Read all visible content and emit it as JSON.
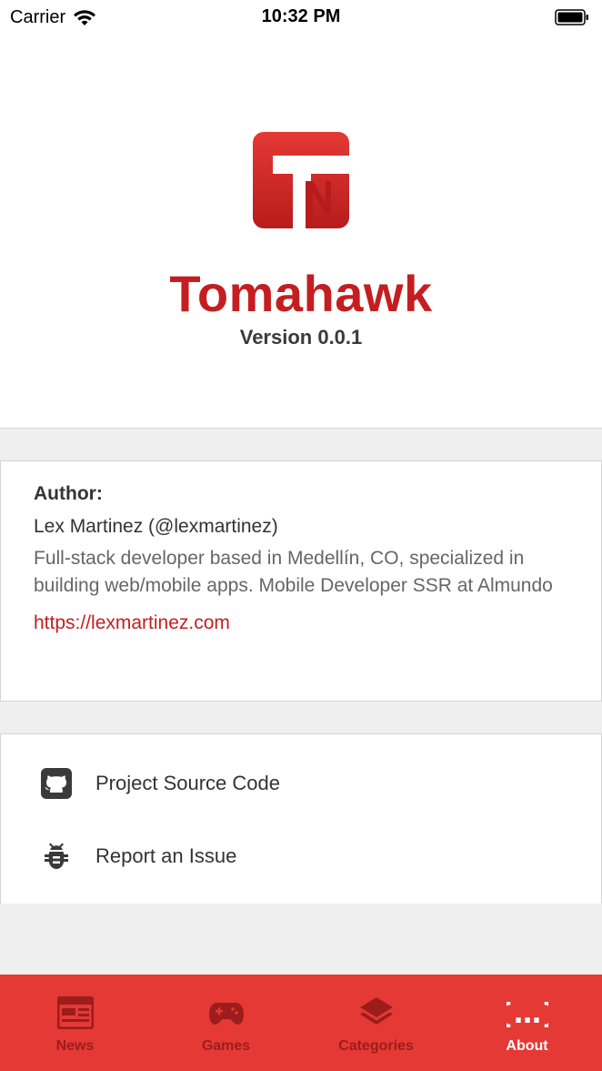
{
  "status_bar": {
    "carrier": "Carrier",
    "time": "10:32 PM"
  },
  "header": {
    "app_name": "Tomahawk",
    "version": "Version 0.0.1"
  },
  "author": {
    "label": "Author:",
    "name": "Lex Martinez (@lexmartinez)",
    "bio": "Full-stack developer based in Medellín, CO, specialized in building web/mobile apps. Mobile Developer SSR at Almundo",
    "url": "https://lexmartinez.com"
  },
  "links": [
    {
      "label": "Project Source Code",
      "icon": "github-icon"
    },
    {
      "label": "Report an Issue",
      "icon": "bug-icon"
    }
  ],
  "tabs": [
    {
      "label": "News",
      "icon": "newspaper-icon",
      "active": false
    },
    {
      "label": "Games",
      "icon": "gamepad-icon",
      "active": false
    },
    {
      "label": "Categories",
      "icon": "layers-icon",
      "active": false
    },
    {
      "label": "About",
      "icon": "code-braces-icon",
      "active": true
    }
  ],
  "colors": {
    "brand": "#c41e21",
    "tab_bar": "#e53935",
    "tab_inactive": "#9c1d1b",
    "tab_active": "#ffffff"
  }
}
